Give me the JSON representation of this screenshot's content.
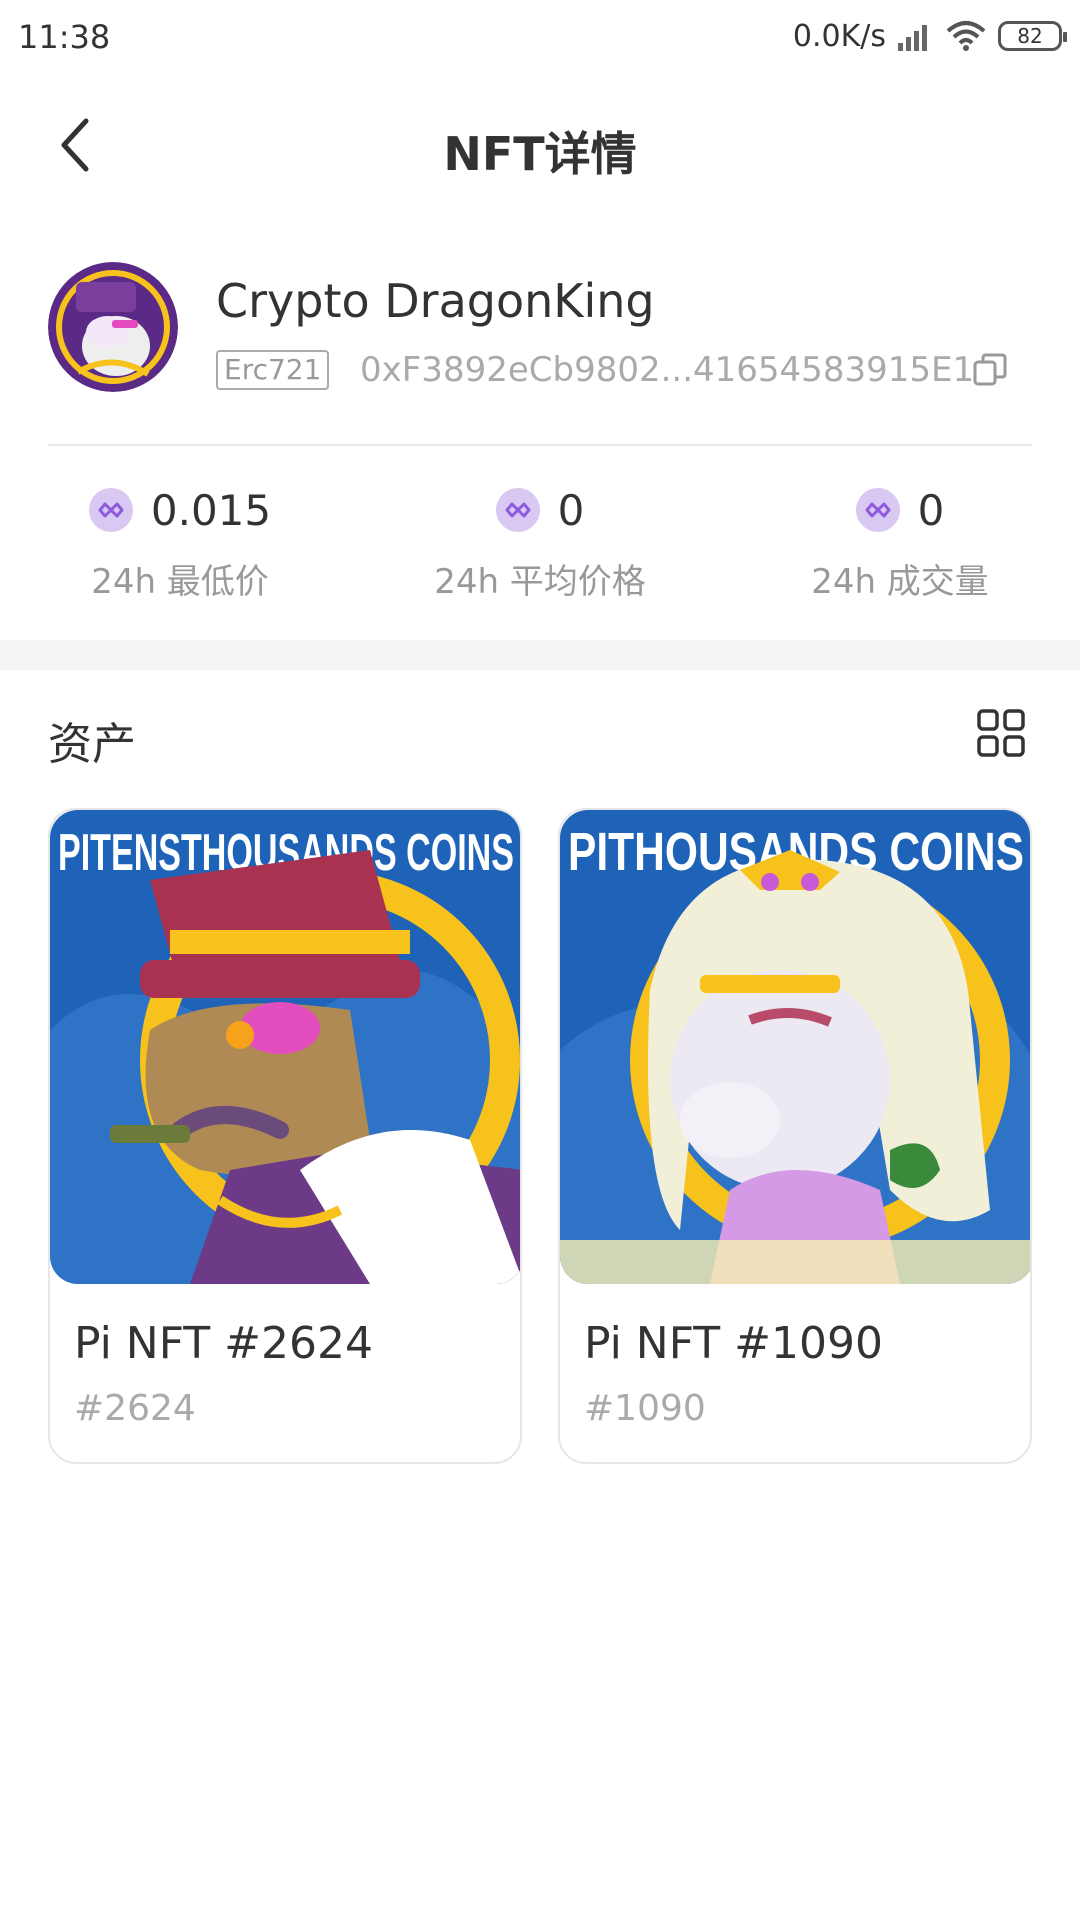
{
  "status_bar": {
    "time": "11:38",
    "net_speed": "0.0K/s",
    "battery": "82"
  },
  "header": {
    "title": "NFT详情",
    "back_icon": "chevron-left-icon"
  },
  "collection": {
    "name": "Crypto DragonKing",
    "standard": "Erc721",
    "contract_address": "0xF3892eCb9802...41654583915E1",
    "copy_icon": "copy-icon"
  },
  "stats": [
    {
      "value": "0.015",
      "label": "24h 最低价",
      "icon": "matic-icon"
    },
    {
      "value": "0",
      "label": "24h 平均价格",
      "icon": "matic-icon"
    },
    {
      "value": "0",
      "label": "24h 成交量",
      "icon": "matic-icon"
    }
  ],
  "assets": {
    "title": "资产",
    "view_icon": "grid-view-icon",
    "items": [
      {
        "name": "Pi NFT #2624",
        "token_id": "#2624",
        "art_text": "PITENSTHOUSANDS COINS"
      },
      {
        "name": "Pi NFT #1090",
        "token_id": "#1090",
        "art_text": "PITHOUSANDS COINS"
      }
    ]
  },
  "colors": {
    "accent_purple": "#8e5be0",
    "matic_bg": "#d9c8f2",
    "art_blue": "#1e63b8",
    "art_yellow": "#f6c21b"
  }
}
